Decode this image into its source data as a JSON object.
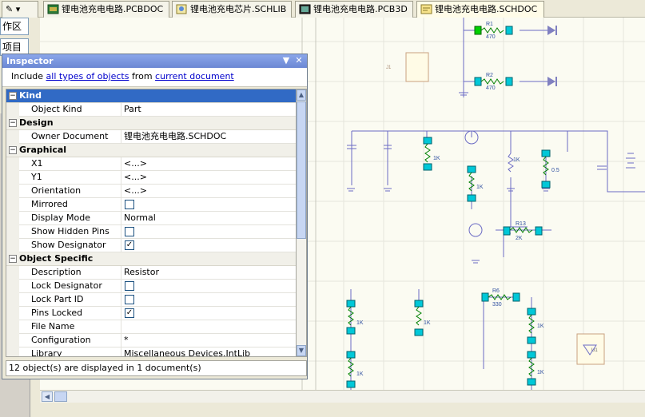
{
  "tabs": [
    {
      "label": "锂电池充电电路.PCBDOC",
      "icon": "pcb-doc-icon"
    },
    {
      "label": "锂电池充电芯片.SCHLIB",
      "icon": "schlib-icon"
    },
    {
      "label": "锂电池充电电路.PCB3D",
      "icon": "pcb3d-icon"
    },
    {
      "label": "锂电池充电电路.SCHDOC",
      "icon": "schdoc-icon"
    }
  ],
  "left_panel": {
    "item1": "作区",
    "item2": "项目"
  },
  "inspector": {
    "title": "Inspector",
    "filter": {
      "include": "Include",
      "all_types": "all types of objects",
      "from": "from",
      "scope": "current document"
    },
    "status": "12 object(s) are displayed in 1 document(s)",
    "categories": {
      "kind": "Kind",
      "design": "Design",
      "graphical": "Graphical",
      "object_specific": "Object Specific"
    },
    "rows": {
      "object_kind": {
        "label": "Object Kind",
        "value": "Part"
      },
      "owner_document": {
        "label": "Owner Document",
        "value": "锂电池充电电路.SCHDOC"
      },
      "x1": {
        "label": "X1",
        "value": "<...>"
      },
      "y1": {
        "label": "Y1",
        "value": "<...>"
      },
      "orientation": {
        "label": "Orientation",
        "value": "<...>"
      },
      "mirrored": {
        "label": "Mirrored",
        "checked": false
      },
      "display_mode": {
        "label": "Display Mode",
        "value": "Normal"
      },
      "show_hidden_pins": {
        "label": "Show Hidden Pins",
        "checked": false
      },
      "show_designator": {
        "label": "Show Designator",
        "checked": true
      },
      "description": {
        "label": "Description",
        "value": "Resistor"
      },
      "lock_designator": {
        "label": "Lock Designator",
        "checked": false
      },
      "lock_part_id": {
        "label": "Lock Part ID",
        "checked": false
      },
      "pins_locked": {
        "label": "Pins Locked",
        "checked": true
      },
      "file_name": {
        "label": "File Name",
        "value": ""
      },
      "configuration": {
        "label": "Configuration",
        "value": "*"
      },
      "library": {
        "label": "Library",
        "value": "Miscellaneous Devices.IntLib"
      }
    }
  },
  "schematic": {
    "labels": {
      "r1": "R1",
      "r1_val": "470",
      "r2": "R2",
      "r2_val": "470",
      "r9_val": "1K",
      "r10_val": "1K",
      "r11_val": "1K",
      "r12_val": "0.5",
      "r13": "R13",
      "r13_val": "2K",
      "r6": "R6",
      "r6_val": "330",
      "r3_val": "1K",
      "r4_val": "1K",
      "r5_val": "1K",
      "r7_val": "1K",
      "r8_val": "1K"
    }
  },
  "colors": {
    "accent": "#316ac5",
    "selection_green": "#00d000",
    "pin_cyan": "#00c8d8",
    "wire": "#6060c0"
  }
}
